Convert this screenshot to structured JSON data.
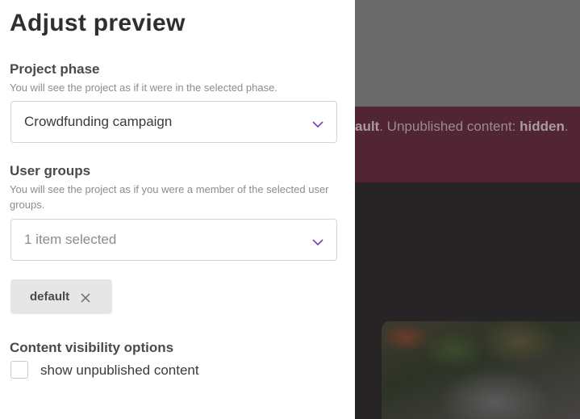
{
  "background": {
    "banner_prefix": "ault",
    "banner_middle": ". Unpublished content: ",
    "banner_bold": "hidden",
    "banner_suffix": "."
  },
  "panel": {
    "title": "Adjust preview",
    "project_phase": {
      "label": "Project phase",
      "help": "You will see the project as if it were in the selected phase.",
      "value": "Crowdfunding campaign",
      "icon": "chevron-down-icon"
    },
    "user_groups": {
      "label": "User groups",
      "help": "You will see the project as if you were a member of the selected user groups.",
      "placeholder": "1 item selected",
      "icon": "chevron-down-icon",
      "tags": [
        {
          "label": "default",
          "icon": "close-icon"
        }
      ]
    },
    "content_visibility": {
      "label": "Content visibility options",
      "checkbox_label": "show unpublished content",
      "checked": false
    }
  },
  "colors": {
    "accent": "#7b3fb5",
    "banner": "#512533"
  }
}
